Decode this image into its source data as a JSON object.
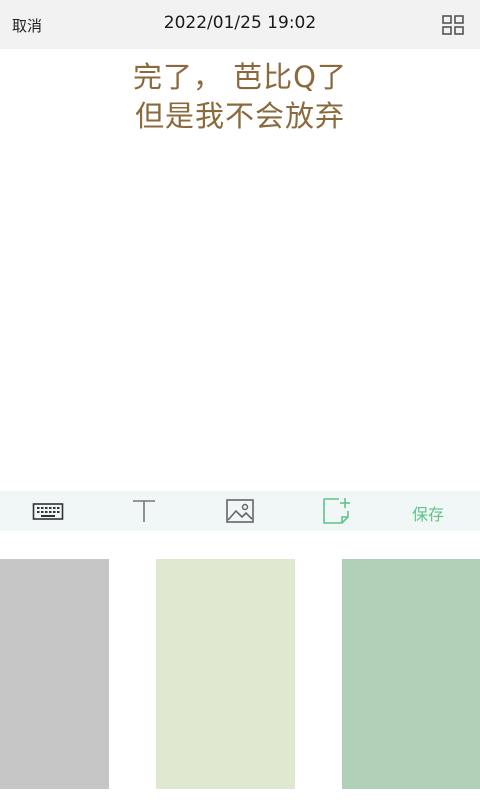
{
  "header": {
    "cancel_label": "取消",
    "datetime": "2022/01/25 19:02",
    "layout_icon": "grid-icon"
  },
  "note": {
    "lines": [
      "完了， 芭比Q了",
      "但是我不会放弃"
    ],
    "text_color": "#8a6a3c"
  },
  "toolbar": {
    "tools": [
      "keyboard-icon",
      "text-icon",
      "image-icon",
      "add-note-icon"
    ],
    "active_tool": "add-note-icon",
    "save_label": "保存",
    "accent_color": "#5fc48a"
  },
  "backgrounds": {
    "swatches": [
      "#c6c6c6",
      "#e0e9cf",
      "#afd0b7"
    ]
  }
}
